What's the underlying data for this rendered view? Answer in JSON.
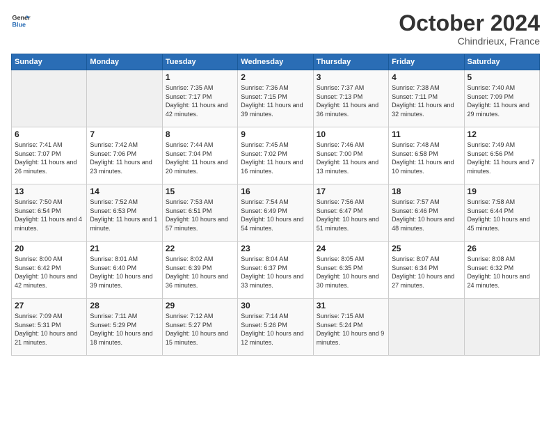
{
  "logo": {
    "line1": "General",
    "line2": "Blue"
  },
  "title": "October 2024",
  "location": "Chindrieux, France",
  "days_of_week": [
    "Sunday",
    "Monday",
    "Tuesday",
    "Wednesday",
    "Thursday",
    "Friday",
    "Saturday"
  ],
  "weeks": [
    [
      {
        "num": "",
        "detail": ""
      },
      {
        "num": "",
        "detail": ""
      },
      {
        "num": "1",
        "detail": "Sunrise: 7:35 AM\nSunset: 7:17 PM\nDaylight: 11 hours\nand 42 minutes."
      },
      {
        "num": "2",
        "detail": "Sunrise: 7:36 AM\nSunset: 7:15 PM\nDaylight: 11 hours\nand 39 minutes."
      },
      {
        "num": "3",
        "detail": "Sunrise: 7:37 AM\nSunset: 7:13 PM\nDaylight: 11 hours\nand 36 minutes."
      },
      {
        "num": "4",
        "detail": "Sunrise: 7:38 AM\nSunset: 7:11 PM\nDaylight: 11 hours\nand 32 minutes."
      },
      {
        "num": "5",
        "detail": "Sunrise: 7:40 AM\nSunset: 7:09 PM\nDaylight: 11 hours\nand 29 minutes."
      }
    ],
    [
      {
        "num": "6",
        "detail": "Sunrise: 7:41 AM\nSunset: 7:07 PM\nDaylight: 11 hours\nand 26 minutes."
      },
      {
        "num": "7",
        "detail": "Sunrise: 7:42 AM\nSunset: 7:06 PM\nDaylight: 11 hours\nand 23 minutes."
      },
      {
        "num": "8",
        "detail": "Sunrise: 7:44 AM\nSunset: 7:04 PM\nDaylight: 11 hours\nand 20 minutes."
      },
      {
        "num": "9",
        "detail": "Sunrise: 7:45 AM\nSunset: 7:02 PM\nDaylight: 11 hours\nand 16 minutes."
      },
      {
        "num": "10",
        "detail": "Sunrise: 7:46 AM\nSunset: 7:00 PM\nDaylight: 11 hours\nand 13 minutes."
      },
      {
        "num": "11",
        "detail": "Sunrise: 7:48 AM\nSunset: 6:58 PM\nDaylight: 11 hours\nand 10 minutes."
      },
      {
        "num": "12",
        "detail": "Sunrise: 7:49 AM\nSunset: 6:56 PM\nDaylight: 11 hours\nand 7 minutes."
      }
    ],
    [
      {
        "num": "13",
        "detail": "Sunrise: 7:50 AM\nSunset: 6:54 PM\nDaylight: 11 hours\nand 4 minutes."
      },
      {
        "num": "14",
        "detail": "Sunrise: 7:52 AM\nSunset: 6:53 PM\nDaylight: 11 hours\nand 1 minute."
      },
      {
        "num": "15",
        "detail": "Sunrise: 7:53 AM\nSunset: 6:51 PM\nDaylight: 10 hours\nand 57 minutes."
      },
      {
        "num": "16",
        "detail": "Sunrise: 7:54 AM\nSunset: 6:49 PM\nDaylight: 10 hours\nand 54 minutes."
      },
      {
        "num": "17",
        "detail": "Sunrise: 7:56 AM\nSunset: 6:47 PM\nDaylight: 10 hours\nand 51 minutes."
      },
      {
        "num": "18",
        "detail": "Sunrise: 7:57 AM\nSunset: 6:46 PM\nDaylight: 10 hours\nand 48 minutes."
      },
      {
        "num": "19",
        "detail": "Sunrise: 7:58 AM\nSunset: 6:44 PM\nDaylight: 10 hours\nand 45 minutes."
      }
    ],
    [
      {
        "num": "20",
        "detail": "Sunrise: 8:00 AM\nSunset: 6:42 PM\nDaylight: 10 hours\nand 42 minutes."
      },
      {
        "num": "21",
        "detail": "Sunrise: 8:01 AM\nSunset: 6:40 PM\nDaylight: 10 hours\nand 39 minutes."
      },
      {
        "num": "22",
        "detail": "Sunrise: 8:02 AM\nSunset: 6:39 PM\nDaylight: 10 hours\nand 36 minutes."
      },
      {
        "num": "23",
        "detail": "Sunrise: 8:04 AM\nSunset: 6:37 PM\nDaylight: 10 hours\nand 33 minutes."
      },
      {
        "num": "24",
        "detail": "Sunrise: 8:05 AM\nSunset: 6:35 PM\nDaylight: 10 hours\nand 30 minutes."
      },
      {
        "num": "25",
        "detail": "Sunrise: 8:07 AM\nSunset: 6:34 PM\nDaylight: 10 hours\nand 27 minutes."
      },
      {
        "num": "26",
        "detail": "Sunrise: 8:08 AM\nSunset: 6:32 PM\nDaylight: 10 hours\nand 24 minutes."
      }
    ],
    [
      {
        "num": "27",
        "detail": "Sunrise: 7:09 AM\nSunset: 5:31 PM\nDaylight: 10 hours\nand 21 minutes."
      },
      {
        "num": "28",
        "detail": "Sunrise: 7:11 AM\nSunset: 5:29 PM\nDaylight: 10 hours\nand 18 minutes."
      },
      {
        "num": "29",
        "detail": "Sunrise: 7:12 AM\nSunset: 5:27 PM\nDaylight: 10 hours\nand 15 minutes."
      },
      {
        "num": "30",
        "detail": "Sunrise: 7:14 AM\nSunset: 5:26 PM\nDaylight: 10 hours\nand 12 minutes."
      },
      {
        "num": "31",
        "detail": "Sunrise: 7:15 AM\nSunset: 5:24 PM\nDaylight: 10 hours\nand 9 minutes."
      },
      {
        "num": "",
        "detail": ""
      },
      {
        "num": "",
        "detail": ""
      }
    ]
  ]
}
